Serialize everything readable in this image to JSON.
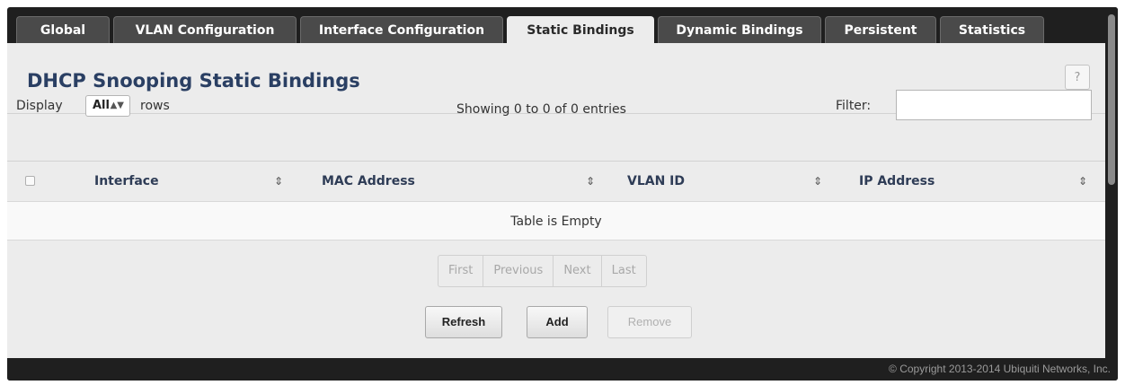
{
  "tabs": [
    {
      "label": "Global",
      "active": false
    },
    {
      "label": "VLAN Configuration",
      "active": false
    },
    {
      "label": "Interface Configuration",
      "active": false
    },
    {
      "label": "Static Bindings",
      "active": true
    },
    {
      "label": "Dynamic Bindings",
      "active": false
    },
    {
      "label": "Persistent",
      "active": false
    },
    {
      "label": "Statistics",
      "active": false
    }
  ],
  "page": {
    "title": "DHCP Snooping Static Bindings",
    "help_label": "?"
  },
  "table_controls": {
    "display_label": "Display",
    "rows_value": "All",
    "rows_label": "rows",
    "showing_text": "Showing 0 to 0 of 0 entries",
    "filter_label": "Filter:",
    "filter_value": "",
    "filter_placeholder": ""
  },
  "table": {
    "columns": [
      "Interface",
      "MAC Address",
      "VLAN ID",
      "IP Address"
    ],
    "empty_text": "Table is Empty"
  },
  "pagination": [
    "First",
    "Previous",
    "Next",
    "Last"
  ],
  "actions": {
    "refresh": "Refresh",
    "add": "Add",
    "remove": "Remove"
  },
  "footer": {
    "copyright": "© Copyright 2013-2014 Ubiquiti Networks, Inc."
  }
}
